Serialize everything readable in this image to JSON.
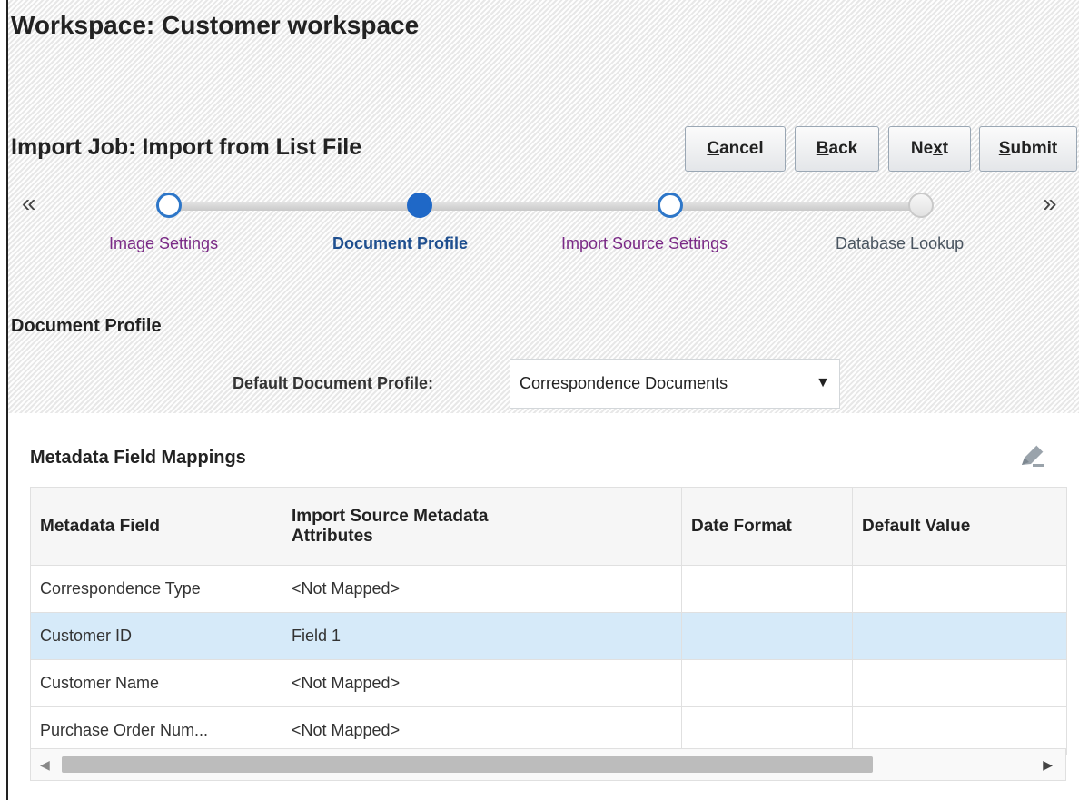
{
  "workspace": {
    "title": "Workspace: Customer workspace"
  },
  "job": {
    "title": "Import Job: Import from List File"
  },
  "buttons": [
    {
      "mnemonic": "C",
      "rest": "ancel",
      "pre": ""
    },
    {
      "mnemonic": "B",
      "rest": "ack",
      "pre": ""
    },
    {
      "pre": "Ne",
      "mnemonic": "x",
      "rest": "t"
    },
    {
      "mnemonic": "S",
      "rest": "ubmit",
      "pre": ""
    }
  ],
  "train": {
    "prev_glyph": "«",
    "next_glyph": "»",
    "steps": [
      {
        "label": "Image Settings",
        "state": "visited",
        "color": "#7a2a86"
      },
      {
        "label": "Document Profile",
        "state": "current",
        "color": "#1f4f8f"
      },
      {
        "label": "Import Source Settings",
        "state": "visited",
        "color": "#7a2a86"
      },
      {
        "label": "Database Lookup",
        "state": "not-reachable",
        "color": "#4a5560"
      }
    ]
  },
  "document_profile": {
    "heading": "Document Profile",
    "default_label": "Default Document Profile:",
    "selected_value": "Correspondence Documents",
    "caret": "▼"
  },
  "mappings": {
    "title": "Metadata Field Mappings",
    "edit_icon": "pencil-icon",
    "columns": [
      "Metadata Field",
      "Import Source Metadata Attributes",
      "Date Format",
      "Default Value"
    ],
    "rows": [
      [
        "Correspondence Type",
        "<Not Mapped>",
        "",
        ""
      ],
      [
        "Customer ID",
        "Field 1",
        "",
        ""
      ],
      [
        "Customer Name",
        "<Not Mapped>",
        "",
        ""
      ],
      [
        "Purchase Order Num...",
        "<Not Mapped>",
        "",
        ""
      ]
    ],
    "selected_row_index": 1,
    "selected_row_color": "#d6eaf9"
  }
}
